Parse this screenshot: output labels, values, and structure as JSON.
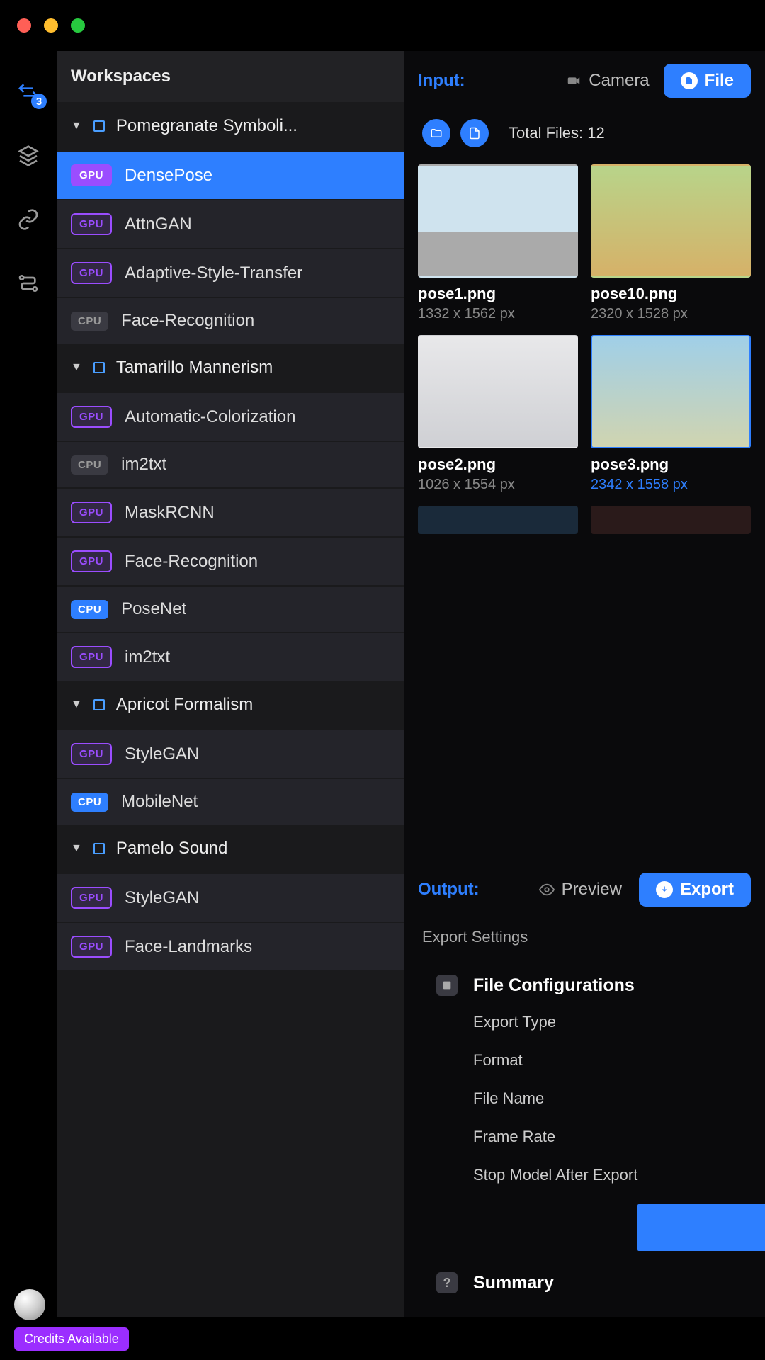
{
  "sidebar": {
    "title": "Workspaces",
    "rail_badge": "3",
    "workspaces": [
      {
        "name": "Pomegranate Symboli...",
        "models": [
          {
            "label": "DensePose",
            "chip": "GPU",
            "selected": true
          },
          {
            "label": "AttnGAN",
            "chip": "GPU"
          },
          {
            "label": "Adaptive-Style-Transfer",
            "chip": "GPU"
          },
          {
            "label": "Face-Recognition",
            "chip": "CPU"
          }
        ]
      },
      {
        "name": "Tamarillo Mannerism",
        "models": [
          {
            "label": "Automatic-Colorization",
            "chip": "GPU"
          },
          {
            "label": "im2txt",
            "chip": "CPU"
          },
          {
            "label": "MaskRCNN",
            "chip": "GPU"
          },
          {
            "label": "Face-Recognition",
            "chip": "GPU"
          },
          {
            "label": "PoseNet",
            "chip": "CPU",
            "blue": true
          },
          {
            "label": "im2txt",
            "chip": "GPU"
          }
        ]
      },
      {
        "name": "Apricot Formalism",
        "models": [
          {
            "label": "StyleGAN",
            "chip": "GPU"
          },
          {
            "label": "MobileNet",
            "chip": "CPU",
            "blue": true
          }
        ]
      },
      {
        "name": "Pamelo Sound",
        "models": [
          {
            "label": "StyleGAN",
            "chip": "GPU"
          },
          {
            "label": "Face-Landmarks",
            "chip": "GPU"
          }
        ]
      }
    ]
  },
  "input": {
    "label": "Input:",
    "camera": "Camera",
    "file": "File",
    "total_files_label": "Total Files: 12",
    "files": [
      {
        "name": "pose1.png",
        "dim": "1332 x 1562 px"
      },
      {
        "name": "pose10.png",
        "dim": "2320 x 1528 px"
      },
      {
        "name": "pose2.png",
        "dim": "1026 x 1554 px"
      },
      {
        "name": "pose3.png",
        "dim": "2342 x 1558 px",
        "selected": true
      }
    ]
  },
  "output": {
    "label": "Output:",
    "preview": "Preview",
    "export": "Export",
    "settings_title": "Export Settings",
    "file_config": {
      "title": "File Configurations",
      "fields": [
        "Export Type",
        "Format",
        "File Name",
        "Frame Rate",
        "Stop Model After Export"
      ]
    },
    "summary_title": "Summary"
  },
  "footer": {
    "credits": "Credits Available"
  }
}
